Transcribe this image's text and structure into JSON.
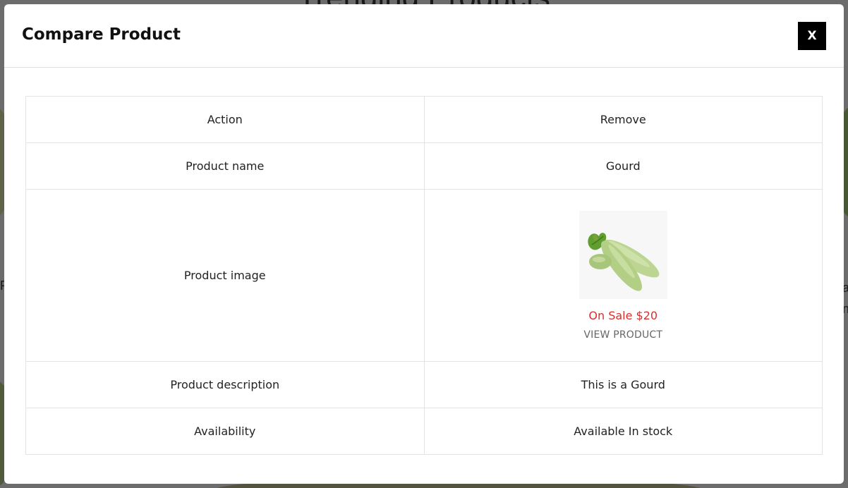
{
  "background": {
    "heading": "Trending Products",
    "left_letter": "P",
    "right_letters": [
      "a",
      "n"
    ]
  },
  "modal": {
    "title": "Compare Product",
    "close_label": "X",
    "rows": {
      "action": {
        "label": "Action",
        "value": "Remove"
      },
      "name": {
        "label": "Product name",
        "value": "Gourd"
      },
      "image": {
        "label": "Product image",
        "sale_text": "On Sale $20",
        "view_label": "VIEW PRODUCT"
      },
      "description": {
        "label": "Product description",
        "value": "This is a Gourd"
      },
      "availability": {
        "label": "Availability",
        "value": "Available In stock"
      }
    }
  },
  "colors": {
    "sale": "#d9302c",
    "close_button": "#000000"
  }
}
